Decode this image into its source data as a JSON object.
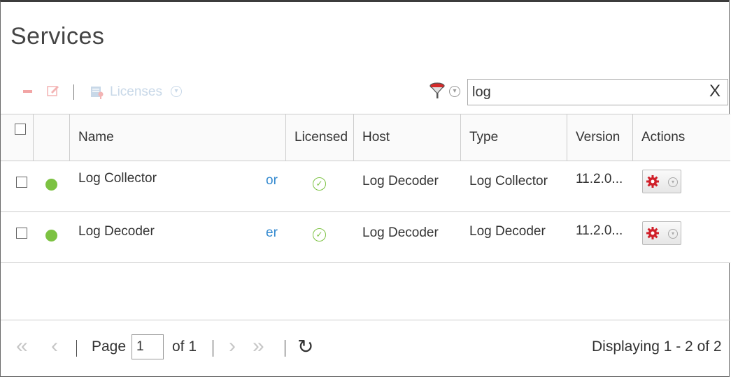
{
  "page": {
    "title": "Services"
  },
  "toolbar": {
    "remove_icon": "minus-icon",
    "edit_icon": "edit-icon",
    "licenses_label": "Licenses",
    "licenses_icon": "license-icon",
    "filter_icon": "funnel-icon",
    "search_value": "log",
    "clear_label": "X"
  },
  "table": {
    "columns": [
      "Name",
      "Licensed",
      "Host",
      "Type",
      "Version",
      "Actions"
    ],
    "rows": [
      {
        "status": "green",
        "name": "Log Collector",
        "name_tail": "or",
        "licensed": true,
        "host": "Log Decoder",
        "type": "Log Collector",
        "version": "11.2.0..."
      },
      {
        "status": "green",
        "name": "Log Decoder",
        "name_tail": "er",
        "licensed": true,
        "host": "Log Decoder",
        "type": "Log Decoder",
        "version": "11.2.0..."
      }
    ]
  },
  "footer": {
    "page_label": "Page",
    "page_value": "1",
    "of_label": "of 1",
    "displaying": "Displaying 1 - 2 of 2"
  },
  "colors": {
    "accent": "#1a7bc9",
    "status_ok": "#7cc242",
    "action_gear": "#d0202a"
  }
}
